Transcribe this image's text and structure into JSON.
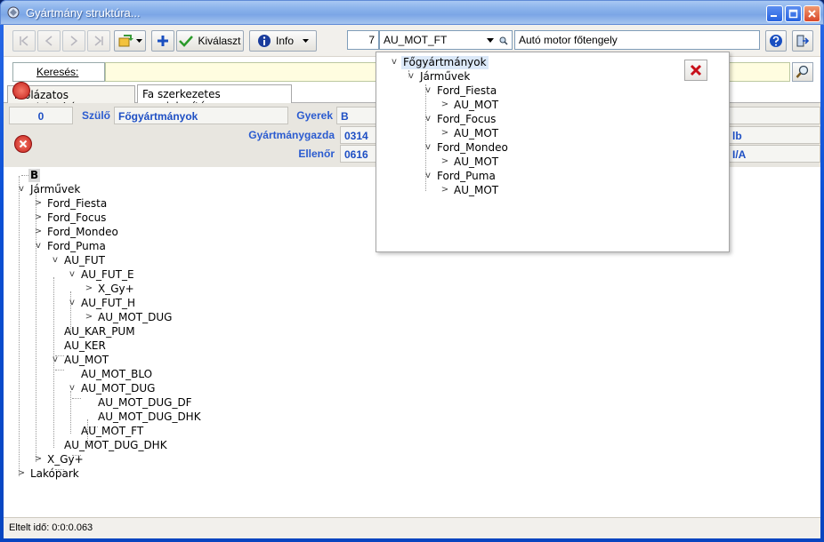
{
  "window": {
    "title": "Gyártmány struktúra..."
  },
  "toolbar": {
    "select_label": "Kiválaszt",
    "info_label": "Info",
    "level_value": "7",
    "code_value": "AU_MOT_FT",
    "description_value": "Autó motor főtengely"
  },
  "search": {
    "label": "Keresés:",
    "value": ""
  },
  "tabs": [
    {
      "label": "Táblázatos megjelenítés"
    },
    {
      "label": "Fa szerkezetes megjelenítés"
    }
  ],
  "info": {
    "id_value": "0",
    "parent_label": "Szülő",
    "parent_value": "Főgyártmányok",
    "child_label": "Gyerek",
    "child_value": "B",
    "owner_label": "Gyártmánygazda",
    "owner_value": "0314",
    "checker_label": "Ellenőr",
    "checker_value": "0616",
    "right_value_1": "lb",
    "right_value_2": "I/A"
  },
  "tree": {
    "root": "B",
    "n1": "Járművek",
    "n2": "Ford_Fiesta",
    "n3": "Ford_Focus",
    "n4": "Ford_Mondeo",
    "n5": "Ford_Puma",
    "n6": "AU_FUT",
    "n7": "AU_FUT_E",
    "n8": "X_Gy+",
    "n9": "AU_FUT_H",
    "n10": "AU_MOT_DUG",
    "n11": "AU_KAR_PUM",
    "n12": "AU_KER",
    "n13": "AU_MOT",
    "n14": "AU_MOT_BLO",
    "n15": "AU_MOT_DUG",
    "n16": "AU_MOT_DUG_DF",
    "n17": "AU_MOT_DUG_DHK",
    "n18": "AU_MOT_FT",
    "n19": "AU_MOT_DUG_DHK",
    "n20": "X_Gy+",
    "n21": "Lakópark"
  },
  "popup": {
    "p1": "Főgyártmányok",
    "p2": "Járművek",
    "p3": "Ford_Fiesta",
    "p4": "AU_MOT",
    "p5": "Ford_Focus",
    "p6": "AU_MOT",
    "p7": "Ford_Mondeo",
    "p8": "AU_MOT",
    "p9": "Ford_Puma",
    "p10": "AU_MOT"
  },
  "status": {
    "text": "Eltelt idő: 0:0:0.063"
  },
  "colors": {
    "title_bar": "#7ba6e6",
    "search_bg": "#fffde0",
    "info_text": "#1e4fc4",
    "close_red": "#d9482a"
  }
}
